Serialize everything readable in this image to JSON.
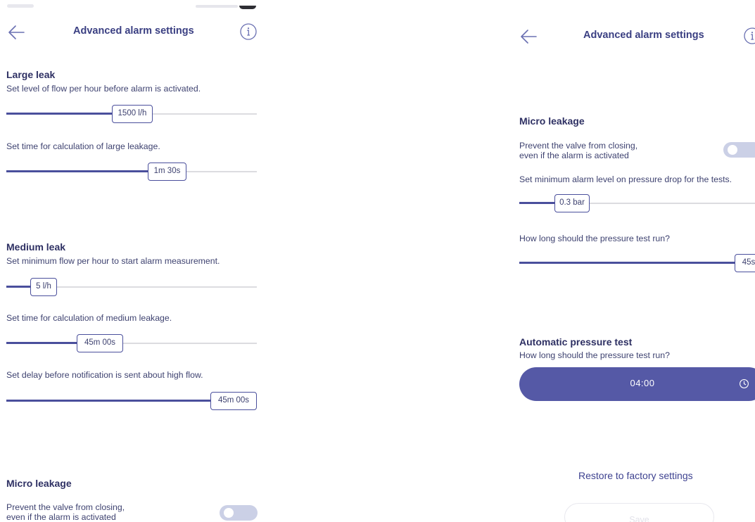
{
  "left": {
    "header": {
      "title": "Advanced alarm settings"
    },
    "large_leak": {
      "title": "Large leak",
      "flow_desc": "Set level of flow per hour before alarm is activated.",
      "flow_value": "1500 l/h",
      "flow_fraction": 0.53,
      "time_desc": "Set time for calculation of large leakage.",
      "time_value": "1m 30s",
      "time_fraction": 0.66
    },
    "medium_leak": {
      "title": "Medium leak",
      "flow_desc": "Set minimum flow per hour to start alarm measurement.",
      "flow_value": "5 l/h",
      "flow_fraction": 0.13,
      "time_desc": "Set time for calculation of medium leakage.",
      "time_value": "45m 00s",
      "time_fraction": 0.38,
      "delay_desc": "Set delay before notification is sent about high flow.",
      "delay_value": "45m 00s",
      "delay_fraction": 1.0
    },
    "micro_leakage": {
      "title": "Micro leakage",
      "prevent_line1": "Prevent the valve from closing,",
      "prevent_line2": "even if the alarm is activated",
      "prevent_enabled": false
    }
  },
  "right": {
    "header": {
      "title": "Advanced alarm settings"
    },
    "micro_leakage": {
      "title": "Micro leakage",
      "prevent_line1": "Prevent the valve from closing,",
      "prevent_line2": "even if the alarm is activated",
      "prevent_enabled": false,
      "pressure_desc": "Set minimum alarm level on pressure drop for the tests.",
      "pressure_value": "0.3 bar",
      "pressure_fraction": 0.15,
      "duration_desc": "How long should the pressure test run?",
      "duration_value": "45s",
      "duration_fraction": 1.0
    },
    "auto_test": {
      "title": "Automatic pressure test",
      "desc": "How long should the pressure test run?",
      "time": "04:00"
    },
    "restore_label": "Restore to factory settings",
    "save_label": "Save"
  },
  "colors": {
    "accent": "#4a4f9c",
    "pill": "#5559a6",
    "title": "#3a3f82",
    "track": "#dcdce0",
    "toggle_off": "#cbd0e6"
  },
  "icons": [
    "back-arrow-icon",
    "info-icon",
    "clock-icon"
  ]
}
